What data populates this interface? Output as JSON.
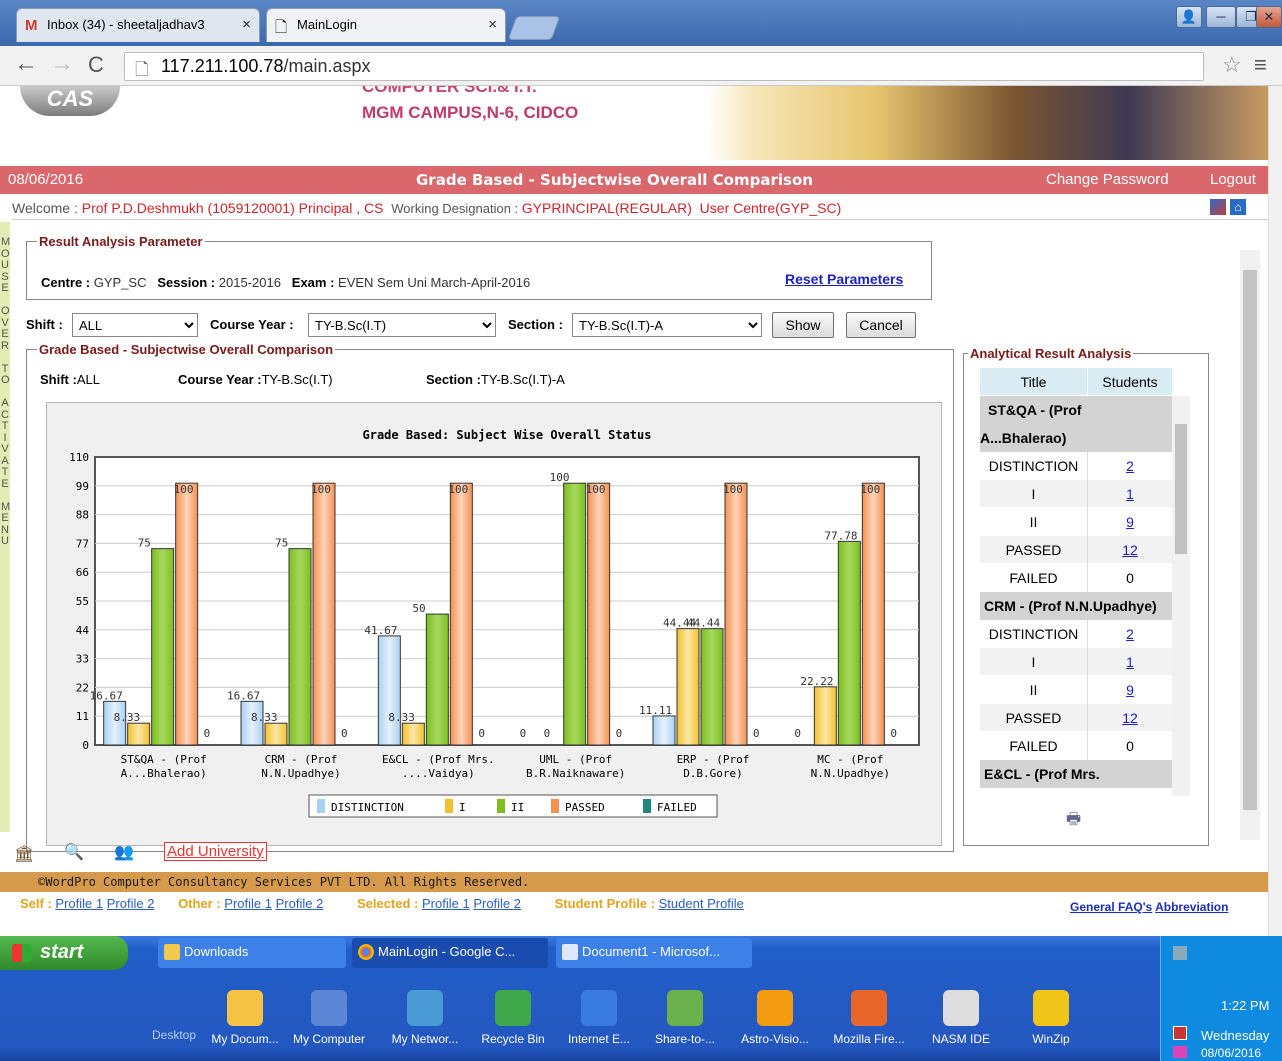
{
  "browser": {
    "tabs": [
      {
        "label": "Inbox (34) - sheetaljadhav3"
      },
      {
        "label": "MainLogin"
      }
    ],
    "url_host": "117.211.100.78",
    "url_path": "/main.aspx"
  },
  "banner": {
    "line1": "COMPUTER SCI.& I.T.",
    "line2": "MGM CAMPUS,N-6, CIDCO",
    "logo": "CAS"
  },
  "header": {
    "date": "08/06/2016",
    "title": "Grade Based - Subjectwise Overall Comparison",
    "change_password": "Change Password",
    "logout": "Logout"
  },
  "welcome": {
    "welcome_label": "Welcome : ",
    "user": "Prof P.D.Deshmukh (1059120001) Principal , CS",
    "desig_label": "Working Designation : ",
    "desig": "GYPRINCIPAL(REGULAR)",
    "centre": "User Centre(GYP_SC)"
  },
  "sidebar_text": "MOUSE OVER TO ACTIVATE MENU",
  "params": {
    "legend": "Result Analysis Parameter",
    "centre_label": "Centre :",
    "centre": "GYP_SC",
    "session_label": "Session :",
    "session": "2015-2016",
    "exam_label": "Exam :",
    "exam": "EVEN Sem Uni March-April-2016",
    "reset": "Reset Parameters"
  },
  "filters": {
    "shift_label": "Shift :",
    "shift": "ALL",
    "course_label": "Course Year :",
    "course": "TY-B.Sc(I.T)",
    "section_label": "Section :",
    "section": "TY-B.Sc(I.T)-A",
    "show": "Show",
    "cancel": "Cancel"
  },
  "comparison": {
    "legend": "Grade Based - Subjectwise Overall Comparison",
    "shift_label": "Shift :",
    "shift": "ALL",
    "course_label": "Course Year :",
    "course": "TY-B.Sc(I.T)",
    "section_label": "Section :",
    "section": "TY-B.Sc(I.T)-A"
  },
  "chart_data": {
    "type": "bar",
    "title": "Grade Based: Subject Wise Overall Status",
    "categories": [
      [
        "ST&QA - (Prof",
        "A...Bhalerao)"
      ],
      [
        "CRM - (Prof",
        "N.N.Upadhye)"
      ],
      [
        "E&CL - (Prof Mrs.",
        "....Vaidya)"
      ],
      [
        "UML - (Prof",
        "B.R.Naiknaware)"
      ],
      [
        "ERP - (Prof",
        "D.B.Gore)"
      ],
      [
        "MC - (Prof",
        "N.N.Upadhye)"
      ]
    ],
    "ylim": [
      0,
      110
    ],
    "yticks": [
      0,
      11,
      22,
      33,
      44,
      55,
      66,
      77,
      88,
      99,
      110
    ],
    "series": [
      {
        "name": "DISTINCTION",
        "color": "#a9d0f2",
        "values": [
          16.67,
          16.67,
          41.67,
          0,
          11.11,
          0
        ]
      },
      {
        "name": "I",
        "color": "#f2c12e",
        "values": [
          8.33,
          8.33,
          8.33,
          0,
          44.44,
          22.22
        ]
      },
      {
        "name": "II",
        "color": "#7cbf1e",
        "values": [
          75,
          75,
          50,
          100,
          44.44,
          77.78
        ]
      },
      {
        "name": "PASSED",
        "color": "#f7904f",
        "values": [
          100,
          100,
          100,
          100,
          100,
          100
        ]
      },
      {
        "name": "FAILED",
        "color": "#1a8a7e",
        "values": [
          0,
          0,
          0,
          0,
          0,
          0
        ]
      }
    ],
    "grid": true,
    "legend_position": "bottom"
  },
  "analysis": {
    "legend": "Analytical Result Analysis",
    "col_title": "Title",
    "col_students": "Students",
    "groups": [
      {
        "name": "ST&QA - (Prof A...Bhalerao)",
        "rows": [
          {
            "t": "DISTINCTION",
            "s": "2",
            "link": true
          },
          {
            "t": "I",
            "s": "1",
            "link": true
          },
          {
            "t": "II",
            "s": "9",
            "link": true
          },
          {
            "t": "PASSED",
            "s": "12",
            "link": true
          },
          {
            "t": "FAILED",
            "s": "0",
            "link": false
          }
        ]
      },
      {
        "name": "CRM - (Prof N.N.Upadhye)",
        "rows": [
          {
            "t": "DISTINCTION",
            "s": "2",
            "link": true
          },
          {
            "t": "I",
            "s": "1",
            "link": true
          },
          {
            "t": "II",
            "s": "9",
            "link": true
          },
          {
            "t": "PASSED",
            "s": "12",
            "link": true
          },
          {
            "t": "FAILED",
            "s": "0",
            "link": false
          }
        ]
      },
      {
        "name": "E&CL - (Prof Mrs.",
        "rows": []
      }
    ]
  },
  "bottom": {
    "add_university": "Add University",
    "footer": "©WordPro Computer Consultancy Services PVT LTD. All Rights Reserved.",
    "self_label": "Self : ",
    "self_p1": "Profile 1",
    "self_p2": "Profile 2",
    "other_label": "Other : ",
    "other_p1": "Profile 1",
    "other_p2": "Profile 2",
    "selected_label": "Selected : ",
    "sel_p1": "Profile 1",
    "sel_p2": "Profile 2",
    "student_label": "Student Profile : ",
    "student_link": "Student Profile",
    "faq": "General FAQ's",
    "abbr": "Abbreviation"
  },
  "taskbar": {
    "start": "start",
    "tasks": [
      {
        "label": "Downloads"
      },
      {
        "label": "MainLogin - Google C..."
      },
      {
        "label": "Document1 - Microsof..."
      }
    ],
    "desktop": "Desktop",
    "icons": [
      {
        "label": "My Docum..."
      },
      {
        "label": "My Computer"
      },
      {
        "label": "My Networ..."
      },
      {
        "label": "Recycle Bin"
      },
      {
        "label": "Internet E..."
      },
      {
        "label": "Share-to-..."
      },
      {
        "label": "Astro-Visio..."
      },
      {
        "label": "Mozilla Fire..."
      },
      {
        "label": "NASM IDE"
      },
      {
        "label": "WinZip"
      }
    ],
    "time": "1:22 PM",
    "day": "Wednesday",
    "date": "08/06/2016"
  }
}
